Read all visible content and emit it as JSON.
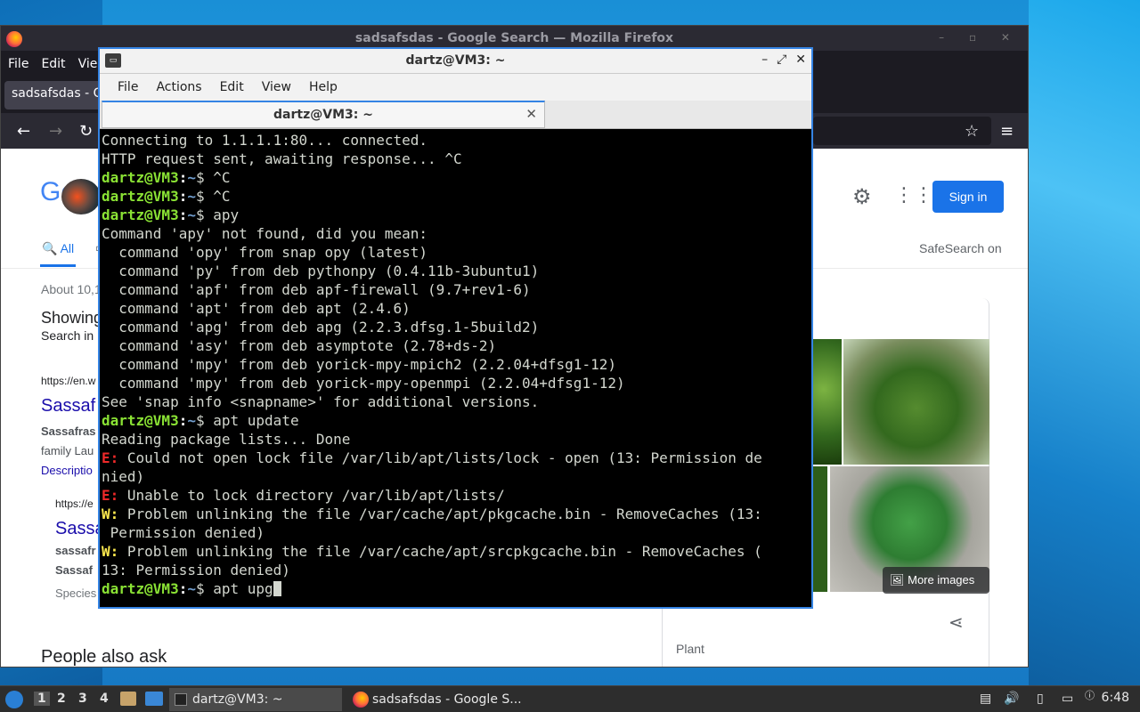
{
  "firefox": {
    "title": "sadsafsdas - Google Search — Mozilla Firefox",
    "menu": [
      "File",
      "Edit",
      "View"
    ],
    "tab_label": "sadsafsdas - G",
    "google": {
      "logo": "Go",
      "sign_in": "Sign in",
      "tab_all": "All",
      "safesearch": "SafeSearch on",
      "about": "About 10,1",
      "showing": "Showing",
      "search_in": "Search in",
      "url1": "https://en.w",
      "link1": "Sassaf",
      "snippet1": "Sassafras",
      "snippet2": "family Lau",
      "description": "Descriptio",
      "url2": "https://e",
      "link2": "Sassa",
      "sub1": "sassafr",
      "sub2": "Sassaf",
      "species": "Species",
      "people_also_ask": "People also ask",
      "more_images": "More images",
      "plant": "Plant"
    }
  },
  "terminal": {
    "title": "dartz@VM3: ~",
    "menu": [
      "File",
      "Actions",
      "Edit",
      "View",
      "Help"
    ],
    "tab_label": "dartz@VM3: ~",
    "prompt_user": "dartz@VM3",
    "prompt_path": "~",
    "lines": [
      {
        "type": "plain",
        "text": "Connecting to 1.1.1.1:80... connected."
      },
      {
        "type": "plain",
        "text": "HTTP request sent, awaiting response... ^C"
      },
      {
        "type": "prompt",
        "text": "$ ^C"
      },
      {
        "type": "prompt",
        "text": "$ ^C"
      },
      {
        "type": "prompt",
        "text": "$ apy"
      },
      {
        "type": "plain",
        "text": "Command 'apy' not found, did you mean:"
      },
      {
        "type": "plain",
        "text": "  command 'opy' from snap opy (latest)"
      },
      {
        "type": "plain",
        "text": "  command 'py' from deb pythonpy (0.4.11b-3ubuntu1)"
      },
      {
        "type": "plain",
        "text": "  command 'apf' from deb apf-firewall (9.7+rev1-6)"
      },
      {
        "type": "plain",
        "text": "  command 'apt' from deb apt (2.4.6)"
      },
      {
        "type": "plain",
        "text": "  command 'apg' from deb apg (2.2.3.dfsg.1-5build2)"
      },
      {
        "type": "plain",
        "text": "  command 'asy' from deb asymptote (2.78+ds-2)"
      },
      {
        "type": "plain",
        "text": "  command 'mpy' from deb yorick-mpy-mpich2 (2.2.04+dfsg1-12)"
      },
      {
        "type": "plain",
        "text": "  command 'mpy' from deb yorick-mpy-openmpi (2.2.04+dfsg1-12)"
      },
      {
        "type": "plain",
        "text": "See 'snap info <snapname>' for additional versions."
      },
      {
        "type": "prompt",
        "text": "$ apt update"
      },
      {
        "type": "plain",
        "text": "Reading package lists... Done"
      },
      {
        "type": "error",
        "tag": "E:",
        "text": " Could not open lock file /var/lib/apt/lists/lock - open (13: Permission de"
      },
      {
        "type": "plain",
        "text": "nied)"
      },
      {
        "type": "error",
        "tag": "E:",
        "text": " Unable to lock directory /var/lib/apt/lists/"
      },
      {
        "type": "warn",
        "tag": "W:",
        "text": " Problem unlinking the file /var/cache/apt/pkgcache.bin - RemoveCaches (13:"
      },
      {
        "type": "plain",
        "text": " Permission denied)"
      },
      {
        "type": "warn",
        "tag": "W:",
        "text": " Problem unlinking the file /var/cache/apt/srcpkgcache.bin - RemoveCaches ("
      },
      {
        "type": "plain",
        "text": "13: Permission denied)"
      },
      {
        "type": "current",
        "text": "$ apt upg"
      }
    ]
  },
  "taskbar": {
    "workspaces": [
      "1",
      "2",
      "3",
      "4"
    ],
    "tasks": [
      "dartz@VM3: ~",
      "sadsafsdas - Google S..."
    ],
    "clock": "6:48"
  }
}
